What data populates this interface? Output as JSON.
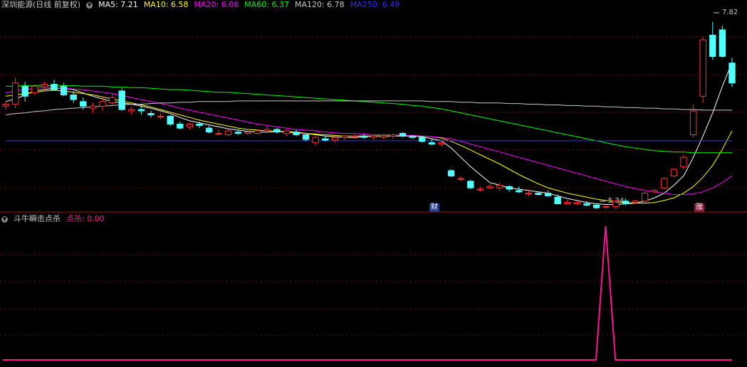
{
  "main_panel": {
    "title": "深圳能源(日线 前复权)",
    "ma_labels": [
      {
        "text": "MA5: 7.21",
        "color": "#ffffff"
      },
      {
        "text": "MA10: 6.58",
        "color": "#ffff00"
      },
      {
        "text": "MA20: 6.06",
        "color": "#ff00ff"
      },
      {
        "text": "MA60: 6.37",
        "color": "#00ff00"
      },
      {
        "text": "MA120: 6.78",
        "color": "#c8c8c8"
      },
      {
        "text": "MA250: 6.49",
        "color": "#3030ff"
      }
    ],
    "high_label": "7.82",
    "low_label": "5.34",
    "marker_cai": "财",
    "marker_zhang": "涨"
  },
  "sub_panel": {
    "title": "斗牛瞬击点杀",
    "value_label": "点杀: 0.00"
  },
  "colors": {
    "up": "#ff3232",
    "down": "#54ffff",
    "spike": "#ff1493",
    "grid": "#8b0000"
  },
  "chart_data": [
    {
      "type": "candlestick",
      "price_range": [
        5.0,
        8.0
      ],
      "candles": [
        [
          6.55,
          6.62,
          6.5,
          6.58
        ],
        [
          6.58,
          6.98,
          6.52,
          6.9
        ],
        [
          6.85,
          6.92,
          6.62,
          6.7
        ],
        [
          6.75,
          6.88,
          6.72,
          6.85
        ],
        [
          6.85,
          6.92,
          6.78,
          6.88
        ],
        [
          6.88,
          6.95,
          6.78,
          6.8
        ],
        [
          6.85,
          6.9,
          6.7,
          6.72
        ],
        [
          6.72,
          6.78,
          6.6,
          6.65
        ],
        [
          6.62,
          6.68,
          6.5,
          6.55
        ],
        [
          6.52,
          6.6,
          6.45,
          6.55
        ],
        [
          6.55,
          6.7,
          6.48,
          6.62
        ],
        [
          6.6,
          6.75,
          6.55,
          6.68
        ],
        [
          6.78,
          6.82,
          6.48,
          6.5
        ],
        [
          6.48,
          6.55,
          6.42,
          6.5
        ],
        [
          6.5,
          6.55,
          6.42,
          6.48
        ],
        [
          6.44,
          6.48,
          6.38,
          6.42
        ],
        [
          6.4,
          6.45,
          6.35,
          6.4
        ],
        [
          6.4,
          6.42,
          6.25,
          6.28
        ],
        [
          6.28,
          6.32,
          6.2,
          6.22
        ],
        [
          6.24,
          6.3,
          6.2,
          6.28
        ],
        [
          6.28,
          6.32,
          6.22,
          6.26
        ],
        [
          6.22,
          6.26,
          6.14,
          6.16
        ],
        [
          6.14,
          6.2,
          6.12,
          6.14
        ],
        [
          6.12,
          6.2,
          6.1,
          6.18
        ],
        [
          6.16,
          6.2,
          6.12,
          6.14
        ],
        [
          6.14,
          6.18,
          6.12,
          6.16
        ],
        [
          6.14,
          6.2,
          6.12,
          6.18
        ],
        [
          6.18,
          6.24,
          6.16,
          6.2
        ],
        [
          6.2,
          6.22,
          6.14,
          6.16
        ],
        [
          6.14,
          6.2,
          6.1,
          6.18
        ],
        [
          6.16,
          6.2,
          6.1,
          6.12
        ],
        [
          6.12,
          6.14,
          6.02,
          6.05
        ],
        [
          6.0,
          6.1,
          5.96,
          6.08
        ],
        [
          6.06,
          6.1,
          6.02,
          6.04
        ],
        [
          6.04,
          6.1,
          6.0,
          6.08
        ],
        [
          6.08,
          6.12,
          6.04,
          6.1
        ],
        [
          6.1,
          6.12,
          6.06,
          6.1
        ],
        [
          6.1,
          6.14,
          6.06,
          6.08
        ],
        [
          6.08,
          6.12,
          6.04,
          6.1
        ],
        [
          6.08,
          6.12,
          6.06,
          6.1
        ],
        [
          6.1,
          6.14,
          6.06,
          6.12
        ],
        [
          6.14,
          6.16,
          6.08,
          6.1
        ],
        [
          6.1,
          6.12,
          6.06,
          6.08
        ],
        [
          6.08,
          6.1,
          6.0,
          6.02
        ],
        [
          6.0,
          6.06,
          5.96,
          5.98
        ],
        [
          5.98,
          6.02,
          5.94,
          6.0
        ],
        [
          5.58,
          5.6,
          5.48,
          5.5
        ],
        [
          5.45,
          5.5,
          5.42,
          5.46
        ],
        [
          5.42,
          5.44,
          5.3,
          5.32
        ],
        [
          5.3,
          5.34,
          5.26,
          5.3
        ],
        [
          5.32,
          5.38,
          5.3,
          5.34
        ],
        [
          5.32,
          5.4,
          5.28,
          5.36
        ],
        [
          5.34,
          5.36,
          5.26,
          5.3
        ],
        [
          5.28,
          5.34,
          5.24,
          5.26
        ],
        [
          5.24,
          5.28,
          5.2,
          5.24
        ],
        [
          5.24,
          5.26,
          5.2,
          5.22
        ],
        [
          5.24,
          5.28,
          5.18,
          5.2
        ],
        [
          5.18,
          5.22,
          5.08,
          5.08
        ],
        [
          5.08,
          5.14,
          5.06,
          5.1
        ],
        [
          5.08,
          5.12,
          5.06,
          5.1
        ],
        [
          5.08,
          5.12,
          5.04,
          5.06
        ],
        [
          5.06,
          5.08,
          5.0,
          5.02
        ],
        [
          5.04,
          5.06,
          5.0,
          5.04
        ],
        [
          5.04,
          5.14,
          5.0,
          5.12
        ],
        [
          5.12,
          5.16,
          5.06,
          5.08
        ],
        [
          5.1,
          5.14,
          5.08,
          5.12
        ],
        [
          5.12,
          5.26,
          5.1,
          5.24
        ],
        [
          5.26,
          5.3,
          5.24,
          5.28
        ],
        [
          5.32,
          5.48,
          5.3,
          5.46
        ],
        [
          5.5,
          5.62,
          5.48,
          5.6
        ],
        [
          5.64,
          5.82,
          5.6,
          5.78
        ],
        [
          6.12,
          6.58,
          6.08,
          6.48
        ],
        [
          6.7,
          7.6,
          6.6,
          7.55
        ],
        [
          7.62,
          7.82,
          7.25,
          7.3
        ],
        [
          7.7,
          7.76,
          7.28,
          7.3
        ],
        [
          7.2,
          7.28,
          6.84,
          6.9
        ]
      ],
      "moving_averages": [
        {
          "name": "MA5",
          "values": [
            6.62,
            6.66,
            6.72,
            6.78,
            6.8,
            6.82,
            6.82,
            6.8,
            6.75,
            6.7,
            6.66,
            6.62,
            6.6,
            6.58,
            6.55,
            6.52,
            6.48,
            6.44,
            6.38,
            6.33,
            6.3,
            6.27,
            6.24,
            6.21,
            6.19,
            6.17,
            6.16,
            6.16,
            6.17,
            6.17,
            6.16,
            6.14,
            6.12,
            6.1,
            6.09,
            6.08,
            6.08,
            6.09,
            6.1,
            6.1,
            6.1,
            6.1,
            6.1,
            6.09,
            6.06,
            6.03,
            5.92,
            5.78,
            5.64,
            5.52,
            5.4,
            5.36,
            5.32,
            5.3,
            5.28,
            5.26,
            5.24,
            5.2,
            5.16,
            5.13,
            5.1,
            5.08,
            5.07,
            5.07,
            5.08,
            5.09,
            5.12,
            5.17,
            5.24,
            5.36,
            5.5,
            5.78,
            6.1,
            6.45,
            6.85,
            7.21
          ]
        },
        {
          "name": "MA10",
          "values": [
            6.7,
            6.72,
            6.74,
            6.76,
            6.78,
            6.79,
            6.78,
            6.76,
            6.74,
            6.72,
            6.69,
            6.66,
            6.63,
            6.6,
            6.57,
            6.54,
            6.5,
            6.46,
            6.42,
            6.38,
            6.34,
            6.31,
            6.28,
            6.25,
            6.22,
            6.2,
            6.19,
            6.18,
            6.17,
            6.16,
            6.15,
            6.14,
            6.13,
            6.12,
            6.11,
            6.1,
            6.1,
            6.1,
            6.1,
            6.1,
            6.1,
            6.1,
            6.1,
            6.1,
            6.09,
            6.07,
            6.02,
            5.96,
            5.89,
            5.82,
            5.75,
            5.68,
            5.6,
            5.52,
            5.45,
            5.38,
            5.32,
            5.28,
            5.24,
            5.21,
            5.18,
            5.15,
            5.13,
            5.11,
            5.1,
            5.09,
            5.09,
            5.1,
            5.13,
            5.17,
            5.24,
            5.34,
            5.48,
            5.66,
            5.9,
            6.18
          ]
        },
        {
          "name": "MA20",
          "values": [
            6.75,
            6.78,
            6.8,
            6.82,
            6.83,
            6.83,
            6.82,
            6.81,
            6.8,
            6.78,
            6.76,
            6.74,
            6.71,
            6.68,
            6.65,
            6.62,
            6.59,
            6.56,
            6.52,
            6.49,
            6.46,
            6.43,
            6.4,
            6.37,
            6.34,
            6.31,
            6.28,
            6.26,
            6.24,
            6.22,
            6.2,
            6.19,
            6.18,
            6.16,
            6.15,
            6.14,
            6.14,
            6.13,
            6.12,
            6.12,
            6.12,
            6.11,
            6.11,
            6.1,
            6.09,
            6.08,
            6.06,
            6.02,
            5.98,
            5.94,
            5.9,
            5.86,
            5.82,
            5.78,
            5.74,
            5.7,
            5.66,
            5.62,
            5.58,
            5.54,
            5.5,
            5.46,
            5.42,
            5.38,
            5.34,
            5.31,
            5.28,
            5.26,
            5.24,
            5.22,
            5.22,
            5.23,
            5.26,
            5.32,
            5.4,
            5.5
          ]
        },
        {
          "name": "MA60",
          "values": [
            6.85,
            6.85,
            6.86,
            6.86,
            6.86,
            6.86,
            6.86,
            6.86,
            6.85,
            6.85,
            6.85,
            6.84,
            6.84,
            6.83,
            6.83,
            6.82,
            6.81,
            6.8,
            6.8,
            6.79,
            6.78,
            6.77,
            6.76,
            6.76,
            6.75,
            6.74,
            6.73,
            6.72,
            6.71,
            6.7,
            6.69,
            6.68,
            6.67,
            6.66,
            6.65,
            6.64,
            6.63,
            6.62,
            6.61,
            6.6,
            6.59,
            6.58,
            6.56,
            6.55,
            6.53,
            6.51,
            6.48,
            6.45,
            6.42,
            6.39,
            6.36,
            6.33,
            6.3,
            6.27,
            6.24,
            6.21,
            6.18,
            6.15,
            6.12,
            6.09,
            6.06,
            6.03,
            6.0,
            5.97,
            5.94,
            5.92,
            5.9,
            5.88,
            5.87,
            5.86,
            5.86,
            5.85,
            5.85,
            5.85,
            5.85,
            5.85
          ]
        },
        {
          "name": "MA120",
          "values": [
            6.42,
            6.44,
            6.45,
            6.47,
            6.48,
            6.5,
            6.51,
            6.52,
            6.53,
            6.54,
            6.55,
            6.56,
            6.57,
            6.58,
            6.58,
            6.59,
            6.6,
            6.6,
            6.61,
            6.61,
            6.62,
            6.62,
            6.62,
            6.62,
            6.63,
            6.63,
            6.63,
            6.63,
            6.63,
            6.63,
            6.63,
            6.63,
            6.63,
            6.63,
            6.63,
            6.63,
            6.63,
            6.63,
            6.63,
            6.63,
            6.63,
            6.63,
            6.63,
            6.63,
            6.62,
            6.62,
            6.62,
            6.61,
            6.61,
            6.6,
            6.6,
            6.6,
            6.59,
            6.59,
            6.58,
            6.58,
            6.57,
            6.57,
            6.56,
            6.56,
            6.55,
            6.55,
            6.54,
            6.54,
            6.53,
            6.53,
            6.52,
            6.52,
            6.51,
            6.51,
            6.5,
            6.5,
            6.49,
            6.49,
            6.49,
            6.49
          ]
        },
        {
          "name": "MA250",
          "values": [
            6.03,
            6.03,
            6.03,
            6.03,
            6.03,
            6.03,
            6.03,
            6.03,
            6.03,
            6.03,
            6.03,
            6.03,
            6.03,
            6.03,
            6.03,
            6.03,
            6.03,
            6.03,
            6.03,
            6.03,
            6.03,
            6.03,
            6.03,
            6.03,
            6.03,
            6.03,
            6.03,
            6.03,
            6.03,
            6.03,
            6.03,
            6.03,
            6.03,
            6.03,
            6.03,
            6.03,
            6.03,
            6.03,
            6.03,
            6.03,
            6.03,
            6.03,
            6.03,
            6.03,
            6.03,
            6.03,
            6.03,
            6.03,
            6.03,
            6.03,
            6.03,
            6.03,
            6.03,
            6.03,
            6.03,
            6.03,
            6.03,
            6.03,
            6.03,
            6.03,
            6.03,
            6.03,
            6.03,
            6.03,
            6.03,
            6.03,
            6.03,
            6.03,
            6.03,
            6.03,
            6.03,
            6.03,
            6.03,
            6.03,
            6.03,
            6.03
          ]
        }
      ],
      "high": 7.82,
      "low": 5.34
    },
    {
      "type": "line",
      "name": "点杀",
      "values": [
        0,
        0,
        0,
        0,
        0,
        0,
        0,
        0,
        0,
        0,
        0,
        0,
        0,
        0,
        0,
        0,
        0,
        0,
        0,
        0,
        0,
        0,
        0,
        0,
        0,
        0,
        0,
        0,
        0,
        0,
        0,
        0,
        0,
        0,
        0,
        0,
        0,
        0,
        0,
        0,
        0,
        0,
        0,
        0,
        0,
        0,
        0,
        0,
        0,
        0,
        0,
        0,
        0,
        0,
        0,
        0,
        0,
        0,
        0,
        0,
        0,
        0,
        1,
        0,
        0,
        0,
        0,
        0,
        0,
        0,
        0,
        0,
        0,
        0,
        0,
        0
      ],
      "ylim": [
        0,
        1
      ]
    }
  ]
}
